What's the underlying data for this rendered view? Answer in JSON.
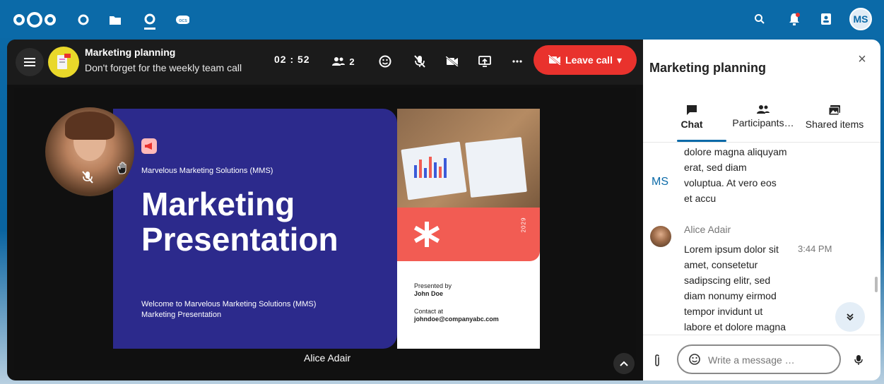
{
  "topbar": {
    "avatar_initials": "MS",
    "apps": [
      "dashboard-icon",
      "files-icon",
      "talk-icon",
      "ocs-icon"
    ],
    "right_icons": [
      "search-icon",
      "notifications-icon",
      "contacts-icon"
    ],
    "app_badge": "ocs"
  },
  "call": {
    "title": "Marketing planning",
    "subtitle": "Don't forget for the weekly team call",
    "timer": "02 : 52",
    "participants_count": "2",
    "leave_label": "Leave call",
    "speaker_name": "Alice Adair"
  },
  "slide": {
    "company": "Marvelous Marketing Solutions (MMS)",
    "title_line1": "Marketing",
    "title_line2": "Presentation",
    "welcome": "Welcome to Marvelous Marketing Solutions (MMS) Marketing Presentation",
    "presented_by_label": "Presented by",
    "presenter": "John Doe",
    "contact_label": "Contact at",
    "contact": "johndoe@companyabc.com",
    "year": "2029"
  },
  "sidebar": {
    "title": "Marketing planning",
    "tabs": [
      {
        "label": "Chat",
        "icon": "chat-icon"
      },
      {
        "label": "Participants…",
        "icon": "participants-icon"
      },
      {
        "label": "Shared items",
        "icon": "shared-items-icon"
      }
    ],
    "messages": [
      {
        "author_initials": "MS",
        "text_lines": [
          "dolore magna aliquyam",
          "erat, sed diam",
          "voluptua. At vero eos",
          "et accu"
        ]
      },
      {
        "author": "Alice Adair",
        "time": "3:44 PM",
        "text_lines": [
          "Lorem ipsum dolor sit",
          "amet, consetetur",
          "sadipscing elitr, sed",
          "diam nonumy eirmod",
          "tempor invidunt ut",
          "labore et dolore magna"
        ]
      }
    ],
    "input_placeholder": "Write a message …"
  },
  "colors": {
    "brand": "#0b6aa8",
    "leave": "#e9322d",
    "slide_blue": "#2c2a8c",
    "slide_red": "#f25c53"
  }
}
